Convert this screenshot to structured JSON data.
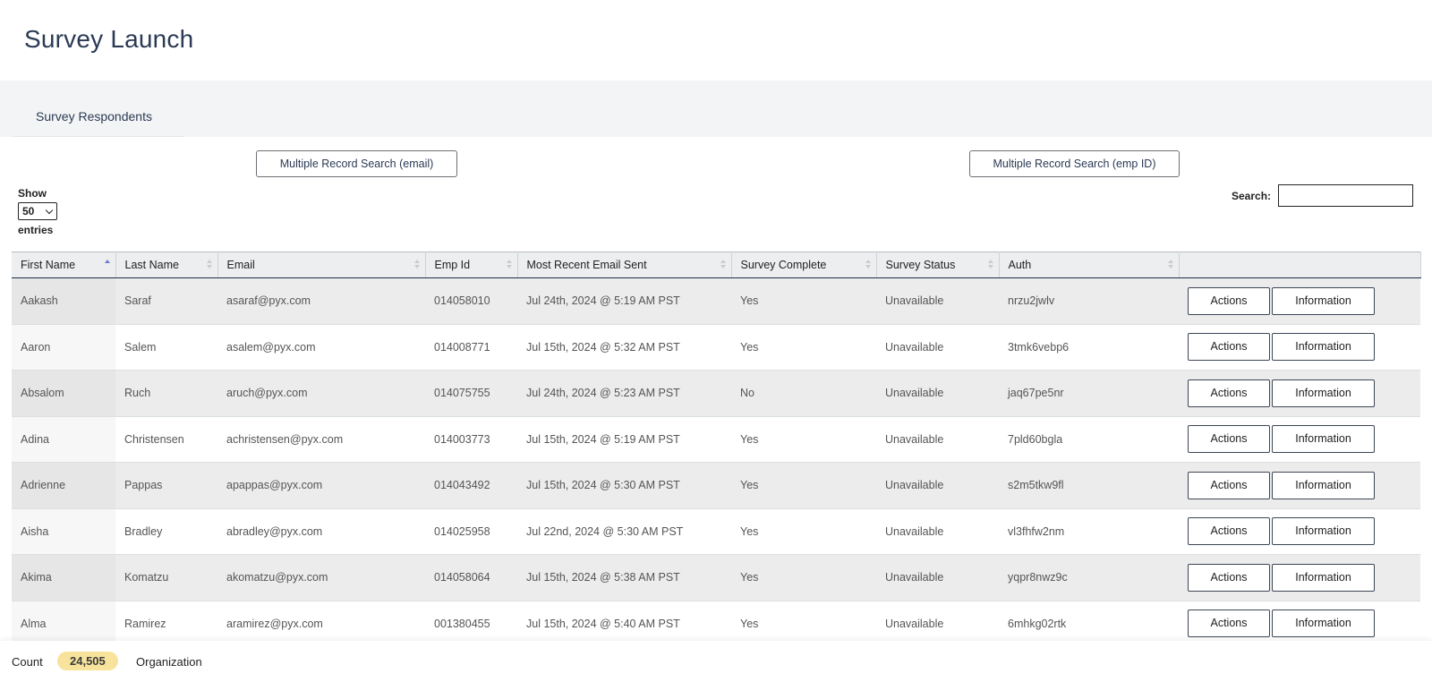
{
  "page": {
    "title": "Survey Launch"
  },
  "tabs": [
    {
      "label": "Survey Respondents",
      "active": true
    }
  ],
  "toolbar": {
    "search_email_label": "Multiple Record Search (email)",
    "search_empid_label": "Multiple Record Search (emp ID)"
  },
  "length_control": {
    "show_label": "Show",
    "selected": "50",
    "entries_label": "entries"
  },
  "search": {
    "label": "Search:",
    "value": "",
    "placeholder": ""
  },
  "table": {
    "columns": [
      "First Name",
      "Last Name",
      "Email",
      "Emp Id",
      "Most Recent Email Sent",
      "Survey Complete",
      "Survey Status",
      "Auth",
      ""
    ],
    "sorted_column": "First Name",
    "sort_direction": "ascending",
    "action_labels": {
      "actions": "Actions",
      "information": "Information"
    },
    "rows": [
      {
        "first": "Aakash",
        "last": "Saraf",
        "email": "asaraf@pyx.com",
        "emp_id": "014058010",
        "sent": "Jul 24th, 2024 @ 5:19 AM PST",
        "complete": "Yes",
        "status": "Unavailable",
        "auth": "nrzu2jwlv"
      },
      {
        "first": "Aaron",
        "last": "Salem",
        "email": "asalem@pyx.com",
        "emp_id": "014008771",
        "sent": "Jul 15th, 2024 @ 5:32 AM PST",
        "complete": "Yes",
        "status": "Unavailable",
        "auth": "3tmk6vebp6"
      },
      {
        "first": "Absalom",
        "last": "Ruch",
        "email": "aruch@pyx.com",
        "emp_id": "014075755",
        "sent": "Jul 24th, 2024 @ 5:23 AM PST",
        "complete": "No",
        "status": "Unavailable",
        "auth": "jaq67pe5nr"
      },
      {
        "first": "Adina",
        "last": "Christensen",
        "email": "achristensen@pyx.com",
        "emp_id": "014003773",
        "sent": "Jul 15th, 2024 @ 5:19 AM PST",
        "complete": "Yes",
        "status": "Unavailable",
        "auth": "7pld60bgla"
      },
      {
        "first": "Adrienne",
        "last": "Pappas",
        "email": "apappas@pyx.com",
        "emp_id": "014043492",
        "sent": "Jul 15th, 2024 @ 5:30 AM PST",
        "complete": "Yes",
        "status": "Unavailable",
        "auth": "s2m5tkw9fl"
      },
      {
        "first": "Aisha",
        "last": "Bradley",
        "email": "abradley@pyx.com",
        "emp_id": "014025958",
        "sent": "Jul 22nd, 2024 @ 5:30 AM PST",
        "complete": "Yes",
        "status": "Unavailable",
        "auth": "vl3fhfw2nm"
      },
      {
        "first": "Akima",
        "last": "Komatzu",
        "email": "akomatzu@pyx.com",
        "emp_id": "014058064",
        "sent": "Jul 15th, 2024 @ 5:38 AM PST",
        "complete": "Yes",
        "status": "Unavailable",
        "auth": "yqpr8nwz9c"
      },
      {
        "first": "Alma",
        "last": "Ramirez",
        "email": "aramirez@pyx.com",
        "emp_id": "001380455",
        "sent": "Jul 15th, 2024 @ 5:40 AM PST",
        "complete": "Yes",
        "status": "Unavailable",
        "auth": "6mhkg02rtk"
      }
    ]
  },
  "footer": {
    "count_label": "Count",
    "count_value": "24,505",
    "org_label": "Organization"
  }
}
